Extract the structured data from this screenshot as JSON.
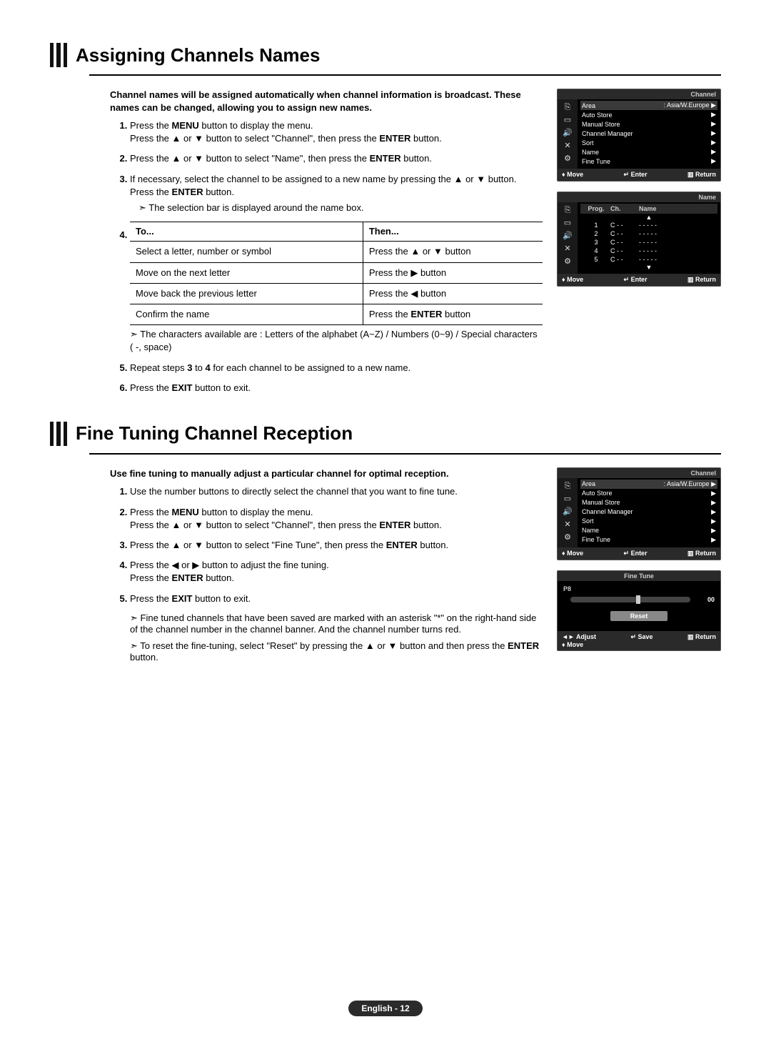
{
  "section1": {
    "title": "Assigning Channels Names",
    "intro": "Channel names will be assigned automatically when channel information is broadcast. These names can be changed, allowing you to assign new names.",
    "steps": [
      "Press the <b>MENU</b> button to display the menu.<br>Press the ▲ or ▼ button to select \"Channel\", then press the <b>ENTER</b> button.",
      "Press the ▲ or ▼ button to select \"Name\", then press the <b>ENTER</b> button.",
      "If necessary, select the channel to be assigned to a new name by pressing the ▲ or ▼ button. Press the <b>ENTER</b> button."
    ],
    "step3_note": "The selection bar is displayed around the name box.",
    "table": {
      "head": [
        "To...",
        "Then..."
      ],
      "rows": [
        [
          "Select a letter, number or symbol",
          "Press the ▲ or ▼ button"
        ],
        [
          "Move on the next letter",
          "Press the ▶ button"
        ],
        [
          "Move back the previous letter",
          "Press the ◀ button"
        ],
        [
          "Confirm the name",
          "Press the <b>ENTER</b> button"
        ]
      ]
    },
    "post_table_note": "The characters available are : Letters of the alphabet (A~Z) / Numbers (0~9) / Special characters ( -, space)",
    "step5": "Repeat steps <b>3</b> to <b>4</b> for each channel to be assigned to a new  name.",
    "step6": "Press the <b>EXIT</b> button to exit."
  },
  "osd_channel": {
    "title": "Channel",
    "items": [
      {
        "label": "Area",
        "value": ": Asia/W.Europe"
      },
      {
        "label": "Auto Store",
        "value": ""
      },
      {
        "label": "Manual Store",
        "value": ""
      },
      {
        "label": "Channel Manager",
        "value": ""
      },
      {
        "label": "Sort",
        "value": ""
      },
      {
        "label": "Name",
        "value": ""
      },
      {
        "label": "Fine Tune",
        "value": ""
      }
    ],
    "foot": {
      "move": "Move",
      "enter": "Enter",
      "return": "Return"
    }
  },
  "osd_name": {
    "title": "Name",
    "head": {
      "prog": "Prog.",
      "ch": "Ch.",
      "name": "Name"
    },
    "rows": [
      {
        "prog": "1",
        "ch": "C - -",
        "name": "- - - - -"
      },
      {
        "prog": "2",
        "ch": "C - -",
        "name": "- - - - -"
      },
      {
        "prog": "3",
        "ch": "C - -",
        "name": "- - - - -"
      },
      {
        "prog": "4",
        "ch": "C - -",
        "name": "- - - - -"
      },
      {
        "prog": "5",
        "ch": "C - -",
        "name": "- - - - -"
      }
    ],
    "foot": {
      "move": "Move",
      "enter": "Enter",
      "return": "Return"
    }
  },
  "section2": {
    "title": "Fine Tuning Channel Reception",
    "intro": "Use fine tuning to manually adjust a particular channel for optimal reception.",
    "steps": [
      "Use the number buttons to directly select the channel that you want to fine tune.",
      "Press the <b>MENU</b> button to display the menu.<br>Press the ▲ or ▼ button to select \"Channel\", then press the <b>ENTER</b> button.",
      "Press the ▲ or ▼ button to select \"Fine Tune\", then press the <b>ENTER</b> button.",
      "Press the ◀ or ▶ button to adjust the fine tuning.<br>Press the <b>ENTER</b> button.",
      "Press the <b>EXIT</b> button to exit."
    ],
    "note1": "Fine tuned channels that have been saved are marked with an asterisk \"*\" on the right-hand side of the channel number in the channel banner. And the channel number turns red.",
    "note2": "To reset the fine-tuning, select \"Reset\" by pressing the ▲ or ▼ button and then press the <b>ENTER</b> button."
  },
  "osd_finetune": {
    "title": "Fine Tune",
    "channel": "P8",
    "value": "00",
    "reset": "Reset",
    "foot": {
      "adjust": "Adjust",
      "move": "Move",
      "save": "Save",
      "return": "Return"
    }
  },
  "page_label": "English - 12"
}
